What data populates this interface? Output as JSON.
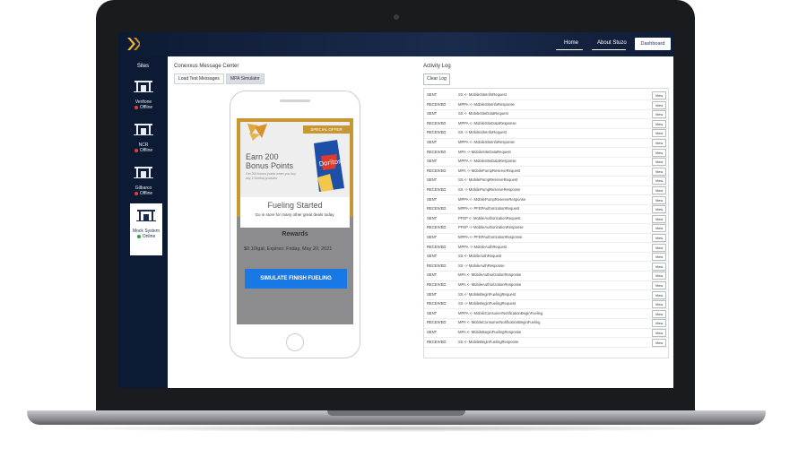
{
  "header": {
    "nav_home": "Home",
    "nav_about": "About Stuzo",
    "dashboard_label": "Dashboard"
  },
  "sidebar": {
    "title": "Sites",
    "sites": [
      {
        "name": "Verifone",
        "status": "Offline",
        "status_color": "#e04040"
      },
      {
        "name": "NCR",
        "status": "Offline",
        "status_color": "#e04040"
      },
      {
        "name": "Gilbarco",
        "status": "Offline",
        "status_color": "#e04040"
      },
      {
        "name": "Mock System",
        "status": "Online",
        "status_color": "#2ea043"
      }
    ]
  },
  "message_center": {
    "title": "Conexxus Message Center",
    "tabs": [
      "Load Test Messages",
      "MPA Simulator"
    ],
    "active_tab": "MPA Simulator"
  },
  "phone": {
    "special_offer": "SPECIAL OFFER",
    "offer_title_line1": "Earn 200",
    "offer_title_line2": "Bonus Points",
    "offer_sub": "Get 200 bonus points when you buy any 2 Doritos products",
    "brand": "Doritos",
    "fueling_title": "Fueling Started",
    "fueling_sub": "Go in store for many other great deals today.",
    "rewards_title": "Rewards",
    "reward_line": "$0.10/gal, Expires: Friday, May 20, 2021",
    "simulate_button": "SIMULATE FINISH FUELING"
  },
  "activity_log": {
    "title": "Activity Log",
    "clear_label": "Clear Log",
    "view_label": "View",
    "rows": [
      {
        "type": "SENT",
        "message": "SS <- MobileSiteInfoRequest"
      },
      {
        "type": "RECEIVED",
        "message": "MPPA <- MobileSiteInfoResponse"
      },
      {
        "type": "SENT",
        "message": "SS <- MobileSiteDataRequest"
      },
      {
        "type": "RECEIVED",
        "message": "MPPA <- MobileSiteDataResponse"
      },
      {
        "type": "RECEIVED",
        "message": "SS -> MobileSiteInfoRequest"
      },
      {
        "type": "SENT",
        "message": "MPPA <- MobileSiteInfoResponse"
      },
      {
        "type": "RECEIVED",
        "message": "MPA -> MobileSiteDataRequest"
      },
      {
        "type": "SENT",
        "message": "MPPA <- MobileSiteDataResponse"
      },
      {
        "type": "RECEIVED",
        "message": "MPA -> MobilePumpReserveRequest"
      },
      {
        "type": "SENT",
        "message": "SS <- MobilePumpReserveRequest"
      },
      {
        "type": "RECEIVED",
        "message": "SS -> MobilePumpReserveResponse"
      },
      {
        "type": "SENT",
        "message": "MPPA <- MobilePumpReserveResponse"
      },
      {
        "type": "RECEIVED",
        "message": "MPPA <- PFEPAuthorizationRequest"
      },
      {
        "type": "SENT",
        "message": "PFEP <- MobileAuthorizationRequest"
      },
      {
        "type": "RECEIVED",
        "message": "PFEP -> MobileAuthorizationResponse"
      },
      {
        "type": "SENT",
        "message": "MPPA <- PFEPAuthorizationResponse"
      },
      {
        "type": "RECEIVED",
        "message": "MPPA -> MobileAuthRequest"
      },
      {
        "type": "SENT",
        "message": "SS <- MobileAuthRequest"
      },
      {
        "type": "RECEIVED",
        "message": "SS -> MobileAuthResponse"
      },
      {
        "type": "SENT",
        "message": "MPA <- MobileAuthorizationResponse"
      },
      {
        "type": "RECEIVED",
        "message": "MPA <- MobileAuthorizationResponse"
      },
      {
        "type": "SENT",
        "message": "SS <- MobileBeginFuelingRequest"
      },
      {
        "type": "RECEIVED",
        "message": "SS -> MobileBeginFuelingRequest"
      },
      {
        "type": "SENT",
        "message": "MPPA <- MobileConsumerNotificationBeginFueling"
      },
      {
        "type": "RECEIVED",
        "message": "MPA <- MobileConsumerNotificationBeginFueling"
      },
      {
        "type": "SENT",
        "message": "MPA <- MobileBeginFuelingResponse"
      },
      {
        "type": "RECEIVED",
        "message": "SS <- MobileBeginFuelingResponse"
      }
    ]
  }
}
